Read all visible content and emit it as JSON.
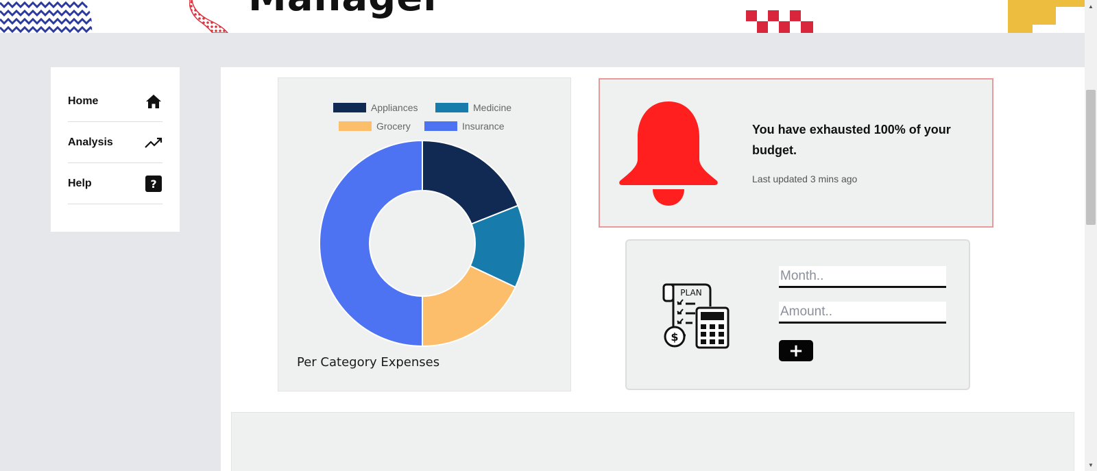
{
  "header": {
    "title": "Manager"
  },
  "sidebar": {
    "items": [
      {
        "label": "Home",
        "icon": "home-icon"
      },
      {
        "label": "Analysis",
        "icon": "trending-up-icon"
      },
      {
        "label": "Help",
        "icon": "help-icon"
      }
    ]
  },
  "chart_data": {
    "type": "pie",
    "title": "Per Category Expenses",
    "legend_position": "top",
    "categories": [
      "Appliances",
      "Medicine",
      "Grocery",
      "Insurance"
    ],
    "values": [
      19,
      13,
      18,
      50
    ],
    "colors": [
      "#112a53",
      "#177bab",
      "#fdbe6c",
      "#4e73f2"
    ]
  },
  "alert": {
    "message": "You have exhausted 100% of your budget.",
    "updated": "Last updated 3 mins ago",
    "icon": "bell-icon",
    "color": "#ff1f1f"
  },
  "budget_form": {
    "icon": "plan-calculator-icon",
    "plan_text": "PLAN",
    "month_placeholder": "Month..",
    "amount_placeholder": "Amount..",
    "add_label": "+"
  },
  "colors": {
    "page_bg": "#e5e7ea",
    "card_bg": "#eff0f0",
    "alert_border": "#e89a9a"
  }
}
